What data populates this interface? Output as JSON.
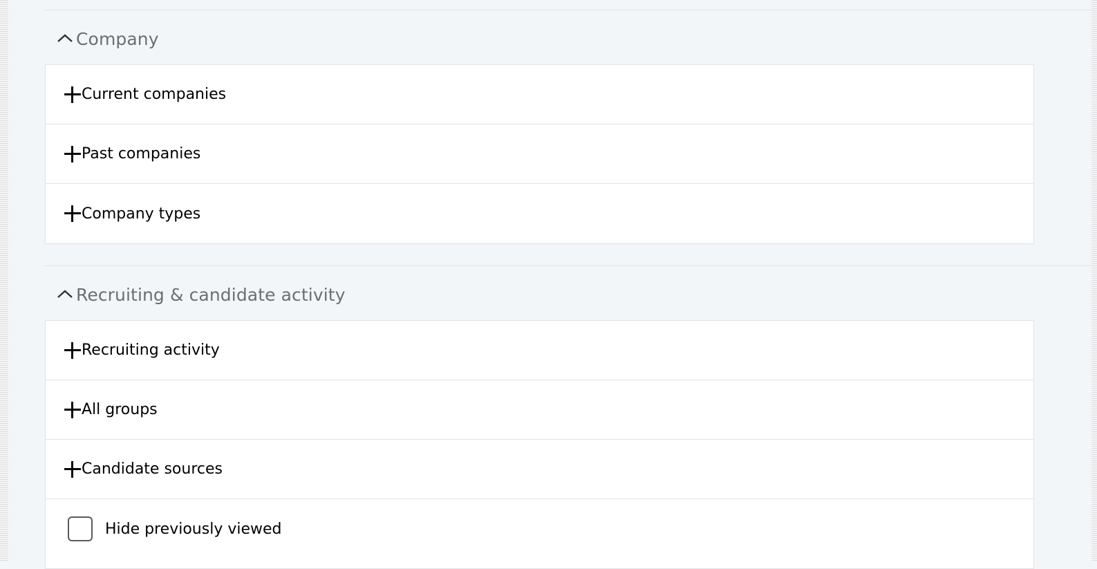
{
  "sections": [
    {
      "title": "Company",
      "expanded": true,
      "items": [
        {
          "label": "Current companies"
        },
        {
          "label": "Past companies"
        },
        {
          "label": "Company types"
        }
      ]
    },
    {
      "title": "Recruiting & candidate activity",
      "expanded": true,
      "items": [
        {
          "label": "Recruiting activity"
        },
        {
          "label": "All groups"
        },
        {
          "label": "Candidate sources"
        }
      ],
      "checkbox": {
        "label": "Hide previously viewed",
        "checked": false
      }
    }
  ],
  "icons": {
    "collapse": "chevron-up-icon",
    "add": "plus-icon"
  },
  "colors": {
    "background": "#f3f6f8",
    "card": "#ffffff",
    "border": "#dfe3e6",
    "header_text": "#6b6f72"
  }
}
